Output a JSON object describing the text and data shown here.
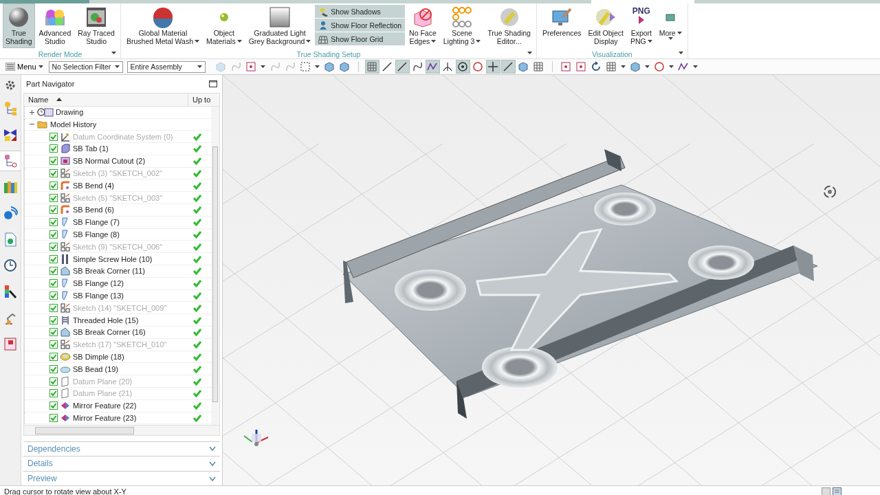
{
  "ribbon": {
    "groups": [
      {
        "title": "Render Mode",
        "items": [
          {
            "kind": "large",
            "lines": [
              "True",
              "Shading"
            ],
            "selected": true,
            "dropdown": false
          },
          {
            "kind": "large",
            "lines": [
              "Advanced",
              "Studio"
            ],
            "selected": false,
            "dropdown": false
          },
          {
            "kind": "large",
            "lines": [
              "Ray Traced",
              "Studio"
            ],
            "selected": false,
            "dropdown": false
          }
        ]
      },
      {
        "title": "True Shading Setup",
        "items": [
          {
            "kind": "large",
            "lines": [
              "Global Material",
              "Brushed Metal Wash"
            ],
            "selected": false,
            "dropdown": true
          },
          {
            "kind": "large",
            "lines": [
              "Object",
              "Materials"
            ],
            "selected": false,
            "dropdown": true
          },
          {
            "kind": "large",
            "lines": [
              "Graduated Light",
              "Grey Background"
            ],
            "selected": false,
            "dropdown": true
          },
          {
            "kind": "stack",
            "toggles": [
              {
                "label": "Show Shadows",
                "on": true
              },
              {
                "label": "Show Floor Reflection",
                "on": true
              },
              {
                "label": "Show Floor Grid",
                "on": true
              }
            ]
          },
          {
            "kind": "large",
            "lines": [
              "No Face",
              "Edges"
            ],
            "selected": false,
            "dropdown": true
          },
          {
            "kind": "large",
            "lines": [
              "Scene",
              "Lighting 3"
            ],
            "selected": false,
            "dropdown": true
          },
          {
            "kind": "large",
            "lines": [
              "True Shading",
              "Editor..."
            ],
            "selected": false,
            "dropdown": false
          }
        ]
      },
      {
        "title": "Visualization",
        "items": [
          {
            "kind": "large",
            "lines": [
              "Preferences"
            ],
            "selected": false,
            "dropdown": false
          },
          {
            "kind": "large",
            "lines": [
              "Edit Object",
              "Display"
            ],
            "selected": false,
            "dropdown": false
          },
          {
            "kind": "large",
            "icon_text": "PNG",
            "lines": [
              "Export",
              "PNG"
            ],
            "selected": false,
            "dropdown": true
          },
          {
            "kind": "large",
            "lines": [
              "More"
            ],
            "selected": false,
            "dropdown": true
          }
        ]
      }
    ]
  },
  "toolbar": {
    "menu": "Menu",
    "selection_filter": "No Selection Filter",
    "scope": "Entire Assembly",
    "tools": [
      {
        "kind": "cube",
        "selected": false,
        "disabled": true,
        "dropdown": false
      },
      {
        "kind": "curve",
        "selected": false,
        "disabled": true,
        "dropdown": false
      },
      {
        "kind": "square",
        "selected": false,
        "disabled": false,
        "dropdown": true
      },
      {
        "kind": "curve",
        "selected": false,
        "disabled": true,
        "dropdown": false
      },
      {
        "kind": "curve",
        "selected": false,
        "disabled": true,
        "dropdown": false
      },
      {
        "kind": "dashed",
        "selected": false,
        "disabled": false,
        "dropdown": true
      },
      {
        "kind": "cube",
        "selected": false,
        "disabled": false,
        "dropdown": false
      },
      {
        "kind": "cube",
        "selected": false,
        "disabled": false,
        "dropdown": false
      },
      {
        "kind": "grid",
        "selected": true,
        "disabled": false,
        "dropdown": false
      },
      {
        "kind": "line",
        "selected": false,
        "disabled": false,
        "dropdown": false
      },
      {
        "kind": "line",
        "selected": true,
        "disabled": false,
        "dropdown": false
      },
      {
        "kind": "curve",
        "selected": false,
        "disabled": false,
        "dropdown": false
      },
      {
        "kind": "zigzag",
        "selected": true,
        "disabled": false,
        "dropdown": false
      },
      {
        "kind": "perp",
        "selected": false,
        "disabled": false,
        "dropdown": false
      },
      {
        "kind": "target",
        "selected": true,
        "disabled": false,
        "dropdown": false
      },
      {
        "kind": "circle",
        "selected": false,
        "disabled": false,
        "dropdown": false
      },
      {
        "kind": "plus",
        "selected": true,
        "disabled": false,
        "dropdown": false
      },
      {
        "kind": "line",
        "selected": true,
        "disabled": false,
        "dropdown": false
      },
      {
        "kind": "cube",
        "selected": false,
        "disabled": false,
        "dropdown": false
      },
      {
        "kind": "grid",
        "selected": false,
        "disabled": false,
        "dropdown": false
      },
      {
        "kind": "square",
        "selected": false,
        "disabled": false,
        "dropdown": false
      },
      {
        "kind": "square",
        "selected": false,
        "disabled": false,
        "dropdown": false
      },
      {
        "kind": "rotate",
        "selected": false,
        "disabled": false,
        "dropdown": false
      },
      {
        "kind": "grid",
        "selected": false,
        "disabled": false,
        "dropdown": true
      },
      {
        "kind": "cube",
        "selected": false,
        "disabled": false,
        "dropdown": true
      },
      {
        "kind": "circle",
        "selected": false,
        "disabled": false,
        "dropdown": true
      },
      {
        "kind": "zigzag",
        "selected": false,
        "disabled": false,
        "dropdown": true
      }
    ]
  },
  "sidebar": {
    "tabs": [
      {
        "selected": false
      },
      {
        "selected": false
      },
      {
        "selected": true
      },
      {
        "selected": false
      },
      {
        "selected": false
      },
      {
        "selected": false
      },
      {
        "selected": false
      },
      {
        "selected": false
      },
      {
        "selected": false
      },
      {
        "selected": false
      }
    ]
  },
  "navigator": {
    "title": "Part Navigator",
    "columns": [
      "Name",
      "Up to"
    ],
    "tree": [
      {
        "name": "Drawing",
        "kind": "drawing",
        "expanded": false
      },
      {
        "name": "Model History",
        "kind": "folder",
        "expanded": true,
        "children": [
          {
            "name": "Datum Coordinate System (0)",
            "kind": "csys",
            "checked": true,
            "dimmed": true,
            "up_to_date": true
          },
          {
            "name": "SB Tab (1)",
            "kind": "tab",
            "checked": true,
            "dimmed": false,
            "up_to_date": true
          },
          {
            "name": "SB Normal Cutout (2)",
            "kind": "cutout",
            "checked": true,
            "dimmed": false,
            "up_to_date": true
          },
          {
            "name": "Sketch (3) \"SKETCH_002\"",
            "kind": "sketch",
            "checked": true,
            "dimmed": true,
            "up_to_date": true
          },
          {
            "name": "SB Bend (4)",
            "kind": "bend",
            "checked": true,
            "dimmed": false,
            "up_to_date": true
          },
          {
            "name": "Sketch (5) \"SKETCH_003\"",
            "kind": "sketch",
            "checked": true,
            "dimmed": true,
            "up_to_date": true
          },
          {
            "name": "SB Bend (6)",
            "kind": "bend",
            "checked": true,
            "dimmed": false,
            "up_to_date": true
          },
          {
            "name": "SB Flange (7)",
            "kind": "flange",
            "checked": true,
            "dimmed": false,
            "up_to_date": true
          },
          {
            "name": "SB Flange (8)",
            "kind": "flange",
            "checked": true,
            "dimmed": false,
            "up_to_date": true
          },
          {
            "name": "Sketch (9) \"SKETCH_006\"",
            "kind": "sketch",
            "checked": true,
            "dimmed": true,
            "up_to_date": true
          },
          {
            "name": "Simple Screw Hole (10)",
            "kind": "hole",
            "checked": true,
            "dimmed": false,
            "up_to_date": true
          },
          {
            "name": "SB Break Corner (11)",
            "kind": "corner",
            "checked": true,
            "dimmed": false,
            "up_to_date": true
          },
          {
            "name": "SB Flange (12)",
            "kind": "flange",
            "checked": true,
            "dimmed": false,
            "up_to_date": true
          },
          {
            "name": "SB Flange (13)",
            "kind": "flange",
            "checked": true,
            "dimmed": false,
            "up_to_date": true
          },
          {
            "name": "Sketch (14) \"SKETCH_009\"",
            "kind": "sketch",
            "checked": true,
            "dimmed": true,
            "up_to_date": true
          },
          {
            "name": "Threaded Hole (15)",
            "kind": "thread",
            "checked": true,
            "dimmed": false,
            "up_to_date": true
          },
          {
            "name": "SB Break Corner (16)",
            "kind": "corner",
            "checked": true,
            "dimmed": false,
            "up_to_date": true
          },
          {
            "name": "Sketch (17) \"SKETCH_010\"",
            "kind": "sketch",
            "checked": true,
            "dimmed": true,
            "up_to_date": true
          },
          {
            "name": "SB Dimple (18)",
            "kind": "dimple",
            "checked": true,
            "dimmed": false,
            "up_to_date": true
          },
          {
            "name": "SB Bead (19)",
            "kind": "bead",
            "checked": true,
            "dimmed": false,
            "up_to_date": true
          },
          {
            "name": "Datum Plane (20)",
            "kind": "plane",
            "checked": true,
            "dimmed": true,
            "up_to_date": true
          },
          {
            "name": "Datum Plane (21)",
            "kind": "plane",
            "checked": true,
            "dimmed": true,
            "up_to_date": true
          },
          {
            "name": "Mirror Feature (22)",
            "kind": "mirror",
            "checked": true,
            "dimmed": false,
            "up_to_date": true
          },
          {
            "name": "Mirror Feature (23)",
            "kind": "mirror",
            "checked": true,
            "dimmed": false,
            "up_to_date": true
          }
        ]
      }
    ],
    "panels": [
      {
        "title": "Dependencies",
        "expanded": false
      },
      {
        "title": "Details",
        "expanded": false
      },
      {
        "title": "Preview",
        "expanded": false
      }
    ]
  },
  "status_bar": {
    "message": "Drag cursor to rotate view about X-Y"
  }
}
